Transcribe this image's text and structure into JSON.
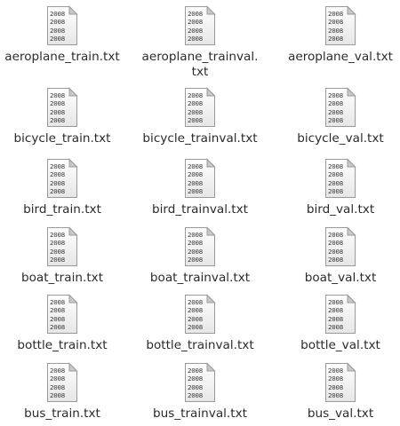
{
  "files": [
    {
      "name": "aeroplane_train.txt",
      "lines": [
        "aeroplane_train.txt"
      ]
    },
    {
      "name": "aeroplane_trainval.txt",
      "lines": [
        "aeroplane_trainval.",
        "txt"
      ]
    },
    {
      "name": "aeroplane_val.txt",
      "lines": [
        "aeroplane_val.txt"
      ]
    },
    {
      "name": "bicycle_train.txt",
      "lines": [
        "bicycle_train.txt"
      ]
    },
    {
      "name": "bicycle_trainval.txt",
      "lines": [
        "bicycle_trainval.txt"
      ]
    },
    {
      "name": "bicycle_val.txt",
      "lines": [
        "bicycle_val.txt"
      ]
    },
    {
      "name": "bird_train.txt",
      "lines": [
        "bird_train.txt"
      ]
    },
    {
      "name": "bird_trainval.txt",
      "lines": [
        "bird_trainval.txt"
      ]
    },
    {
      "name": "bird_val.txt",
      "lines": [
        "bird_val.txt"
      ]
    },
    {
      "name": "boat_train.txt",
      "lines": [
        "boat_train.txt"
      ]
    },
    {
      "name": "boat_trainval.txt",
      "lines": [
        "boat_trainval.txt"
      ]
    },
    {
      "name": "boat_val.txt",
      "lines": [
        "boat_val.txt"
      ]
    },
    {
      "name": "bottle_train.txt",
      "lines": [
        "bottle_train.txt"
      ]
    },
    {
      "name": "bottle_trainval.txt",
      "lines": [
        "bottle_trainval.txt"
      ]
    },
    {
      "name": "bottle_val.txt",
      "lines": [
        "bottle_val.txt"
      ]
    },
    {
      "name": "bus_train.txt",
      "lines": [
        "bus_train.txt"
      ]
    },
    {
      "name": "bus_trainval.txt",
      "lines": [
        "bus_trainval.txt"
      ]
    },
    {
      "name": "bus_val.txt",
      "lines": [
        "bus_val.txt"
      ]
    }
  ],
  "icon": {
    "name": "text-file-icon",
    "preview_lines": [
      "2008",
      "2008",
      "2008",
      "2008"
    ],
    "fold_color": "#c9c9c9",
    "border_color": "#9a9a9a"
  }
}
